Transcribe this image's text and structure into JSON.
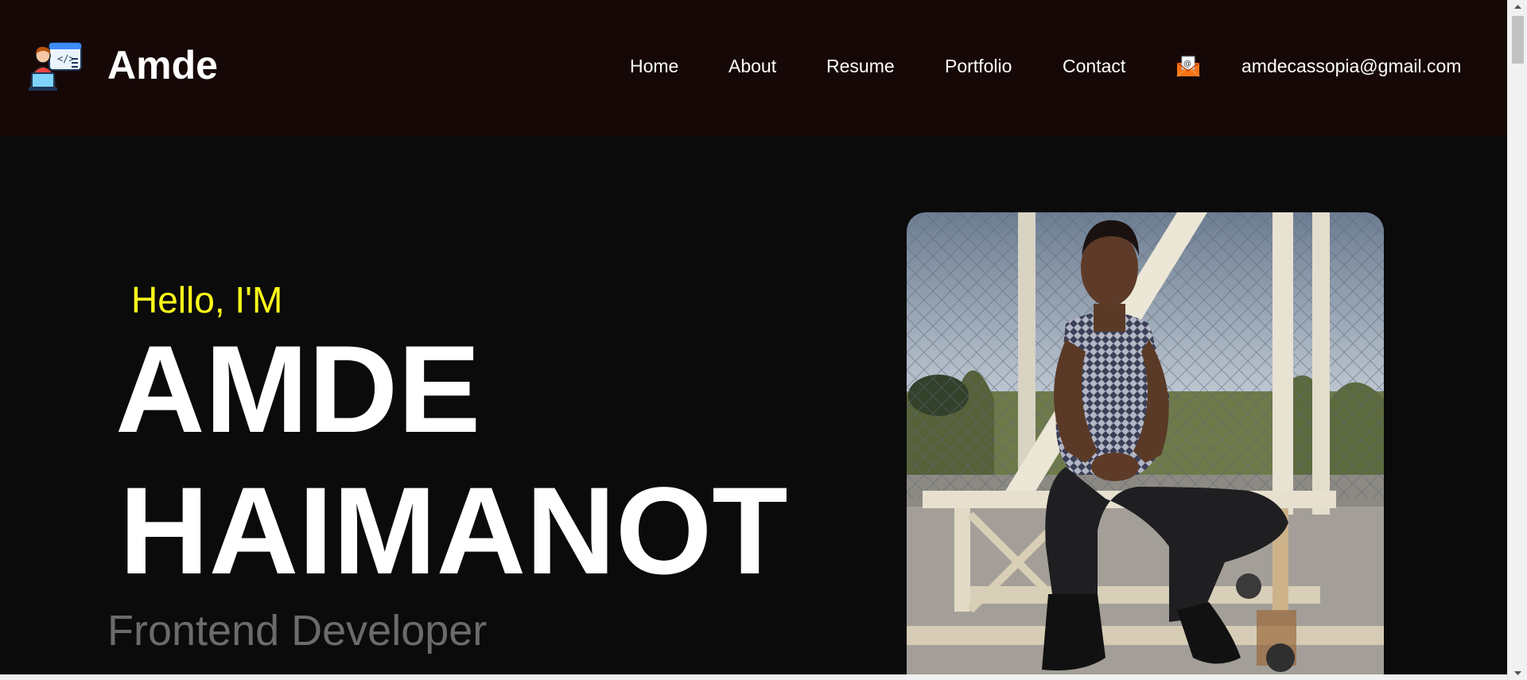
{
  "header": {
    "brand": "Amde",
    "logo_icon": "developer-laptop-icon",
    "nav": [
      {
        "label": "Home"
      },
      {
        "label": "About"
      },
      {
        "label": "Resume"
      },
      {
        "label": "Portfolio"
      },
      {
        "label": "Contact"
      }
    ],
    "mail_icon": "envelope-at-icon",
    "email": "amdecassopia@gmail.com"
  },
  "hero": {
    "greeting": "Hello, I'M",
    "first_name": "AMDE",
    "last_name": "HAIMANOT",
    "role": "Frontend Developer",
    "photo": "portrait-photo"
  },
  "colors": {
    "header_bg": "#170808",
    "page_bg": "#0b0b0b",
    "greeting": "#ffff1a",
    "role": "#6b6b6b"
  }
}
